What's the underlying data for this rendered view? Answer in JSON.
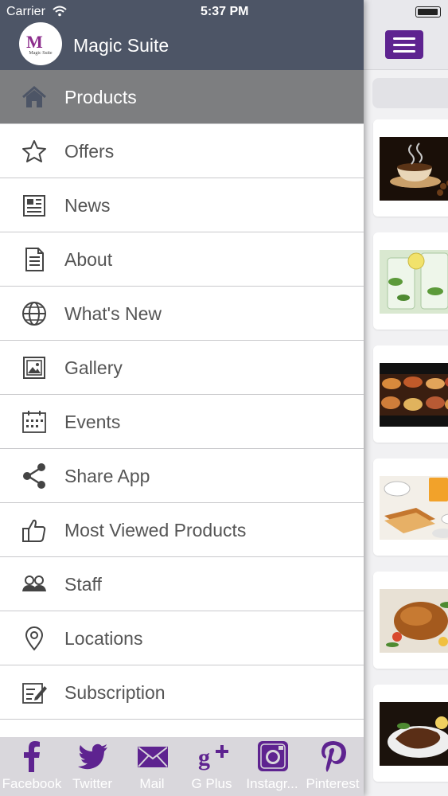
{
  "status_bar": {
    "carrier": "Carrier",
    "time": "5:37 PM"
  },
  "drawer": {
    "app_title": "Magic Suite",
    "logo_text": "Magic Suite",
    "menu": [
      {
        "label": "Products",
        "icon": "home-icon",
        "active": true
      },
      {
        "label": "Offers",
        "icon": "star-icon"
      },
      {
        "label": "News",
        "icon": "newspaper-icon"
      },
      {
        "label": "About",
        "icon": "document-icon"
      },
      {
        "label": "What's New",
        "icon": "globe-icon"
      },
      {
        "label": "Gallery",
        "icon": "image-icon"
      },
      {
        "label": "Events",
        "icon": "calendar-icon"
      },
      {
        "label": "Share App",
        "icon": "share-icon"
      },
      {
        "label": "Most Viewed Products",
        "icon": "thumbs-up-icon"
      },
      {
        "label": "Staff",
        "icon": "people-icon"
      },
      {
        "label": "Locations",
        "icon": "location-pin-icon"
      },
      {
        "label": "Subscription",
        "icon": "edit-form-icon"
      }
    ]
  },
  "social_bar": [
    {
      "label": "Facebook",
      "icon": "facebook-icon"
    },
    {
      "label": "Twitter",
      "icon": "twitter-icon"
    },
    {
      "label": "Mail",
      "icon": "mail-icon"
    },
    {
      "label": "G Plus",
      "icon": "google-plus-icon"
    },
    {
      "label": "Instagr...",
      "icon": "instagram-icon"
    },
    {
      "label": "Pinterest",
      "icon": "pinterest-icon"
    }
  ],
  "colors": {
    "header": "#4d5566",
    "active_row": "#7d7e80",
    "social_purple": "#5e2390",
    "menu_text": "#555555"
  }
}
